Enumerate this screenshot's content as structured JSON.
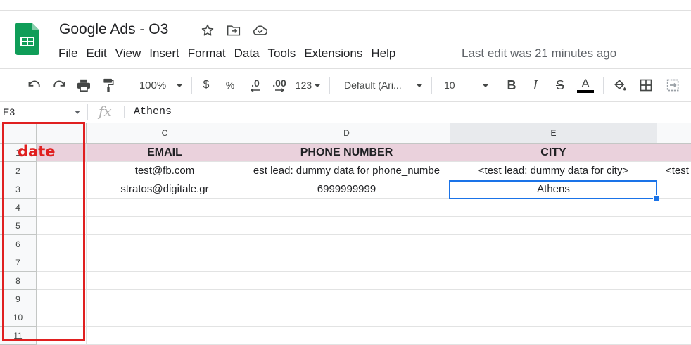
{
  "app": {
    "title": "Google Ads - O3",
    "last_edit": "Last edit was 21 minutes ago",
    "accent_color": "#1a73e8",
    "header_fill": "#ead1dc"
  },
  "menu": [
    "File",
    "Edit",
    "View",
    "Insert",
    "Format",
    "Data",
    "Tools",
    "Extensions",
    "Help"
  ],
  "toolbar": {
    "zoom": "100%",
    "currency": "$",
    "percent": "%",
    "dec_decrease": ".0",
    "dec_increase": ".00",
    "more_formats": "123",
    "font": "Default (Ari...",
    "font_size": "10",
    "bold": "B",
    "italic": "I",
    "strike": "S",
    "text_color": "A"
  },
  "formula_bar": {
    "cell_ref": "E3",
    "fx": "fx",
    "value": "Athens"
  },
  "columns": [
    "C",
    "D",
    "E"
  ],
  "selected_column": "E",
  "rows": [
    {
      "num": "1",
      "cells": [
        "EMAIL",
        "PHONE NUMBER",
        "CITY",
        ""
      ]
    },
    {
      "num": "2",
      "cells": [
        "test@fb.com",
        "est lead: dummy data for phone_numbe",
        "<test lead: dummy data for city>",
        "<test"
      ]
    },
    {
      "num": "3",
      "cells": [
        "stratos@digitale.gr",
        "6999999999",
        "Athens",
        ""
      ]
    },
    {
      "num": "4",
      "cells": [
        "",
        "",
        "",
        ""
      ]
    },
    {
      "num": "5",
      "cells": [
        "",
        "",
        "",
        ""
      ]
    },
    {
      "num": "6",
      "cells": [
        "",
        "",
        "",
        ""
      ]
    },
    {
      "num": "7",
      "cells": [
        "",
        "",
        "",
        ""
      ]
    },
    {
      "num": "8",
      "cells": [
        "",
        "",
        "",
        ""
      ]
    },
    {
      "num": "9",
      "cells": [
        "",
        "",
        "",
        ""
      ]
    },
    {
      "num": "10",
      "cells": [
        "",
        "",
        "",
        ""
      ]
    },
    {
      "num": "11",
      "cells": [
        "",
        "",
        "",
        ""
      ]
    }
  ],
  "annotation": {
    "label": "date",
    "color": "#e02020"
  }
}
